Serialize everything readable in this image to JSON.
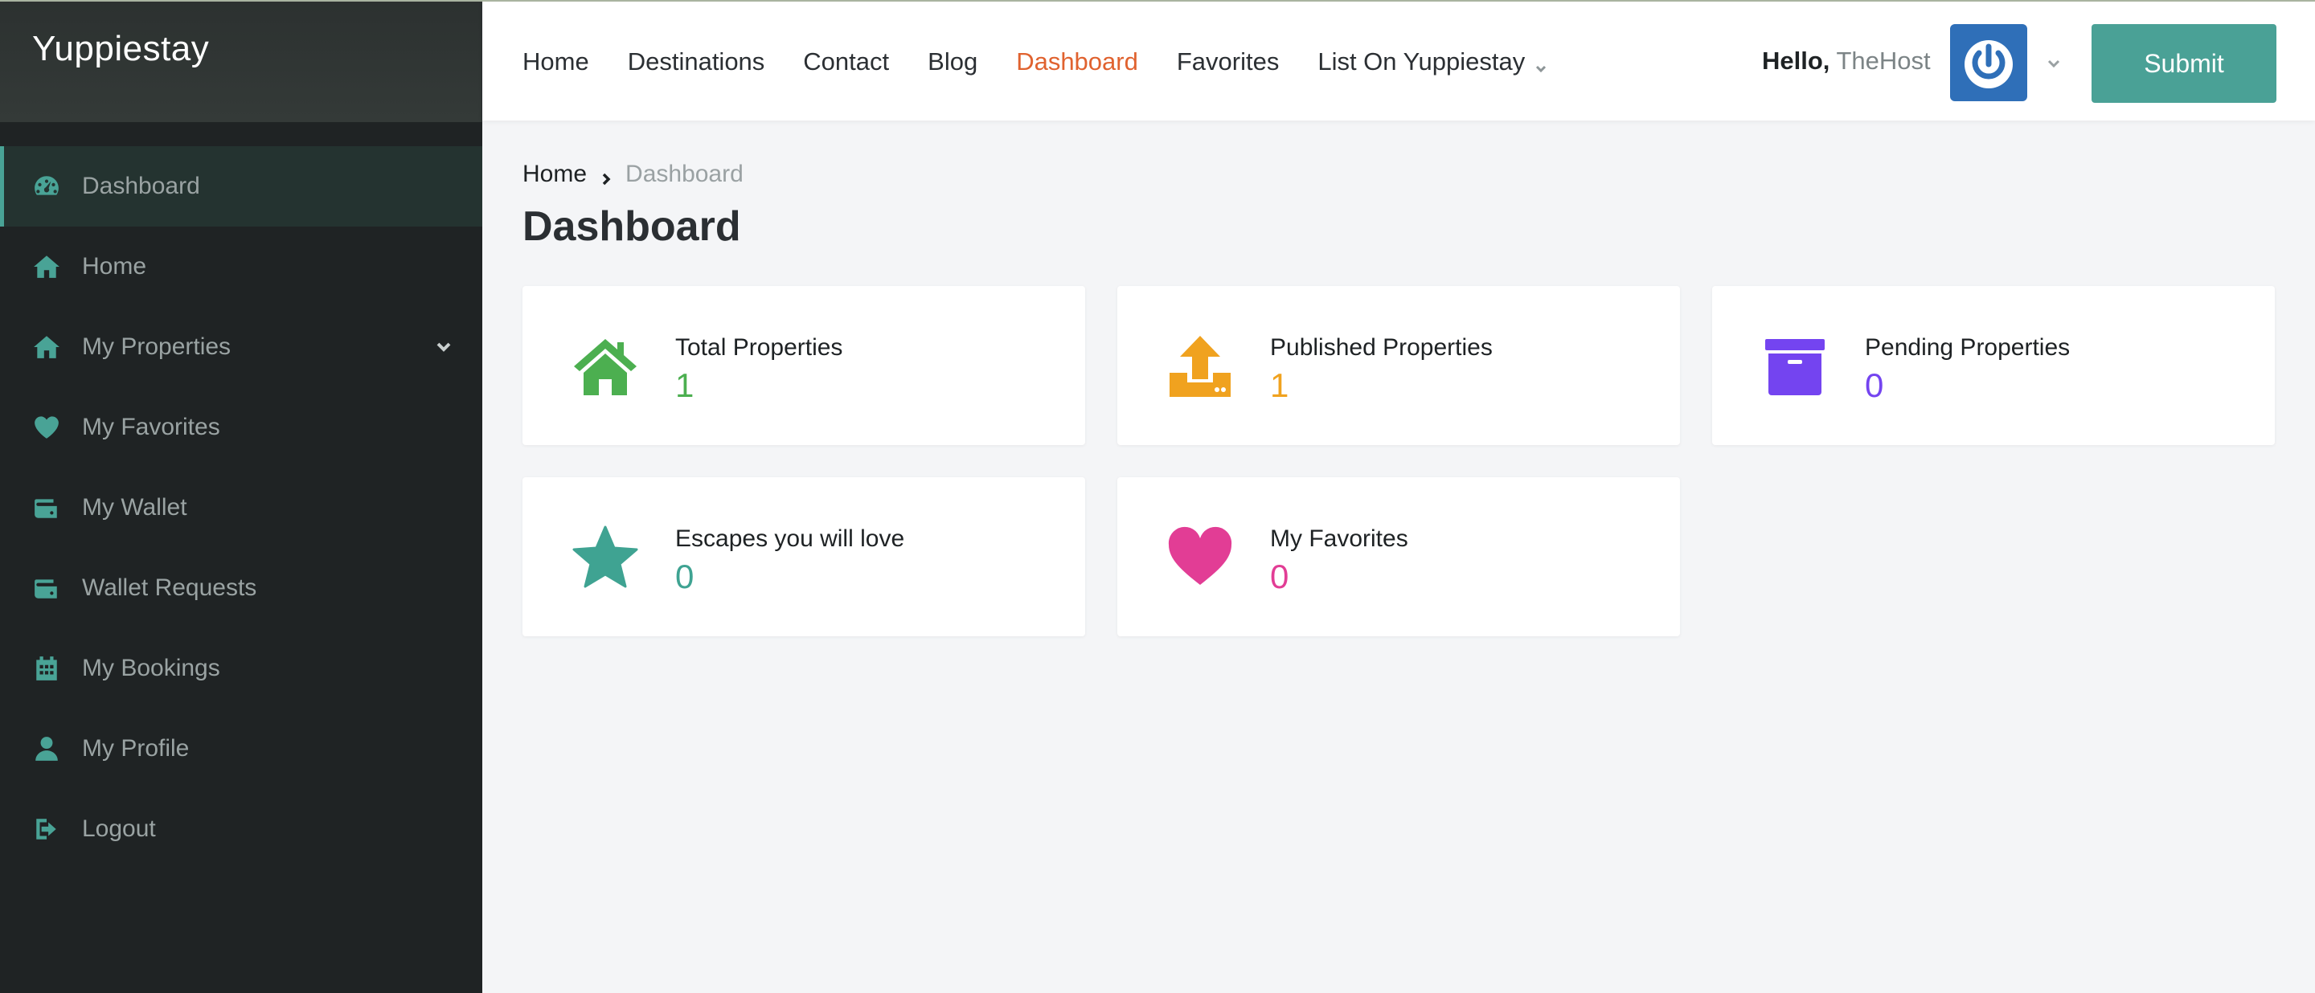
{
  "brand": {
    "name": "Yuppiestay"
  },
  "sidebar": {
    "items": [
      {
        "label": "Dashboard",
        "icon": "dashboard-icon"
      },
      {
        "label": "Home",
        "icon": "home-icon"
      },
      {
        "label": "My Properties",
        "icon": "home-icon"
      },
      {
        "label": "My Favorites",
        "icon": "heart-icon"
      },
      {
        "label": "My Wallet",
        "icon": "wallet-icon"
      },
      {
        "label": "Wallet Requests",
        "icon": "wallet-icon"
      },
      {
        "label": "My Bookings",
        "icon": "calendar-icon"
      },
      {
        "label": "My Profile",
        "icon": "user-icon"
      },
      {
        "label": "Logout",
        "icon": "logout-icon"
      }
    ],
    "active_index": 0,
    "accent_color": "#49a396"
  },
  "header": {
    "nav": [
      {
        "label": "Home"
      },
      {
        "label": "Destinations"
      },
      {
        "label": "Contact"
      },
      {
        "label": "Blog"
      },
      {
        "label": "Dashboard"
      },
      {
        "label": "Favorites"
      },
      {
        "label": "List On Yuppiestay"
      }
    ],
    "active_nav": "Dashboard",
    "hello": "Hello,",
    "username": "TheHost",
    "submit_label": "Submit",
    "active_color": "#e0622f",
    "button_color": "#4aa196"
  },
  "breadcrumb": {
    "home": "Home",
    "current": "Dashboard"
  },
  "page": {
    "title": "Dashboard"
  },
  "cards": [
    {
      "label": "Total Properties",
      "value": "1",
      "icon": "house-icon",
      "color": "#4caf50"
    },
    {
      "label": "Published Properties",
      "value": "1",
      "icon": "upload-icon",
      "color": "#f0a21f"
    },
    {
      "label": "Pending Properties",
      "value": "0",
      "icon": "archive-icon",
      "color": "#7444f0"
    },
    {
      "label": "Escapes you will love",
      "value": "0",
      "icon": "star-icon",
      "color": "#3fa392"
    },
    {
      "label": "My Favorites",
      "value": "0",
      "icon": "heart-icon",
      "color": "#e23d95"
    }
  ]
}
